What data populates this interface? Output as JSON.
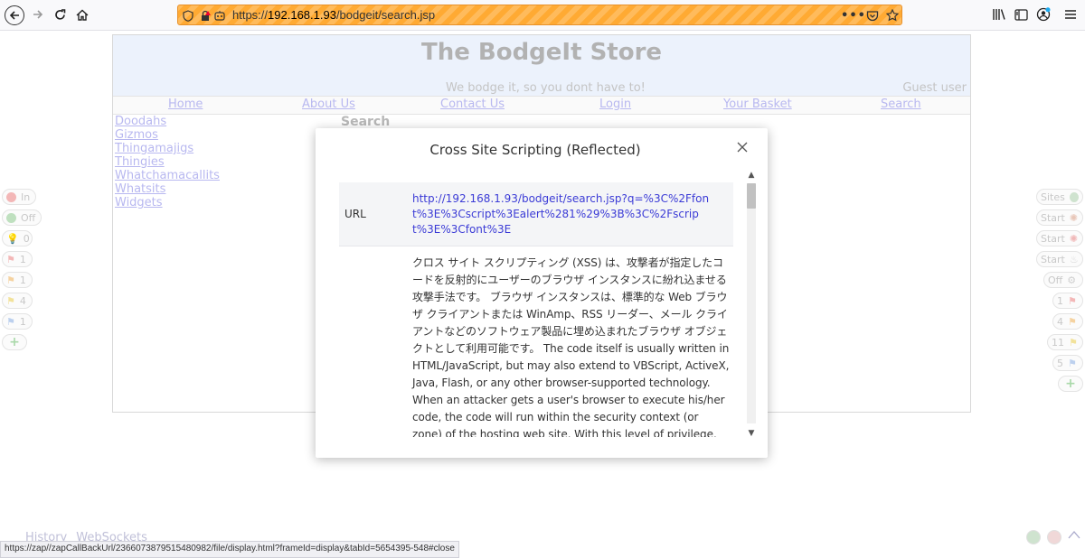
{
  "browser": {
    "url_prefix": "https://",
    "url_host": "192.168.1.93",
    "url_path": "/bodgeit/search.jsp",
    "status_url": "https://zap//zapCallBackUrl/2366073879515480982/file/display.html?frameId=display&tabId=5654395-548#close"
  },
  "store": {
    "title": "The BodgeIt Store",
    "tagline": "We bodge it, so you dont have to!",
    "user": "Guest user",
    "nav": [
      "Home",
      "About Us",
      "Contact Us",
      "Login",
      "Your Basket",
      "Search"
    ],
    "categories": [
      "Doodahs",
      "Gizmos",
      "Thingamajigs",
      "Thingies",
      "Whatchamacallits",
      "Whatsits",
      "Widgets"
    ],
    "search_heading": "Search"
  },
  "zap_left": [
    {
      "label": "In",
      "icon": "red-circle"
    },
    {
      "label": "Off",
      "icon": "green-circle"
    },
    {
      "label": "0",
      "icon": "bulb-icon"
    },
    {
      "label": "1",
      "icon": "red-flag"
    },
    {
      "label": "1",
      "icon": "orange-flag"
    },
    {
      "label": "4",
      "icon": "yellow-flag"
    },
    {
      "label": "1",
      "icon": "blue-flag"
    },
    {
      "label": "",
      "icon": "plus-icon"
    }
  ],
  "zap_right": [
    {
      "label": "Sites",
      "icon": "globe-icon"
    },
    {
      "label": "Start",
      "icon": "spider-icon"
    },
    {
      "label": "Start",
      "icon": "ajax-spider-icon"
    },
    {
      "label": "Start",
      "icon": "flame-icon"
    },
    {
      "label": "Off",
      "icon": "gear-icon"
    },
    {
      "label": "1",
      "icon": "red-flag"
    },
    {
      "label": "4",
      "icon": "orange-flag"
    },
    {
      "label": "11",
      "icon": "yellow-flag"
    },
    {
      "label": "5",
      "icon": "blue-flag"
    },
    {
      "label": "",
      "icon": "plus-icon"
    }
  ],
  "bottom_tabs": [
    "History",
    "WebSockets"
  ],
  "modal": {
    "title": "Cross Site Scripting (Reflected)",
    "url_label": "URL",
    "url_value": "http://192.168.1.93/bodgeit/search.jsp?q=%3C%2Ffont%3E%3Cscript%3Ealert%281%29%3B%3C%2Fscript%3E%3Cfont%3E",
    "description": "クロス サイト スクリプティング (XSS) は、攻撃者が指定したコードを反射的にユーザーのブラウザ インスタンスに紛れ込ませる攻撃手法です。 ブラウザ インスタンスは、標準的な Web ブラウザ クライアントまたは WinAmp、RSS リーダー、メール クライアントなどのソフトウェア製品に埋め込まれたブラウザ オブジェクトとして利用可能です。 The code itself is usually written in HTML/JavaScript, but may also extend to VBScript, ActiveX, Java, Flash, or any other browser-supported technology. When an attacker gets a user's browser to execute his/her code, the code will run within the security context (or zone) of the hosting web site. With this level of privilege, the"
  },
  "colors": {
    "urlbar": "#ffaa33",
    "link": "#3b3bd6",
    "store_header_bg": "#ecf2fc"
  }
}
